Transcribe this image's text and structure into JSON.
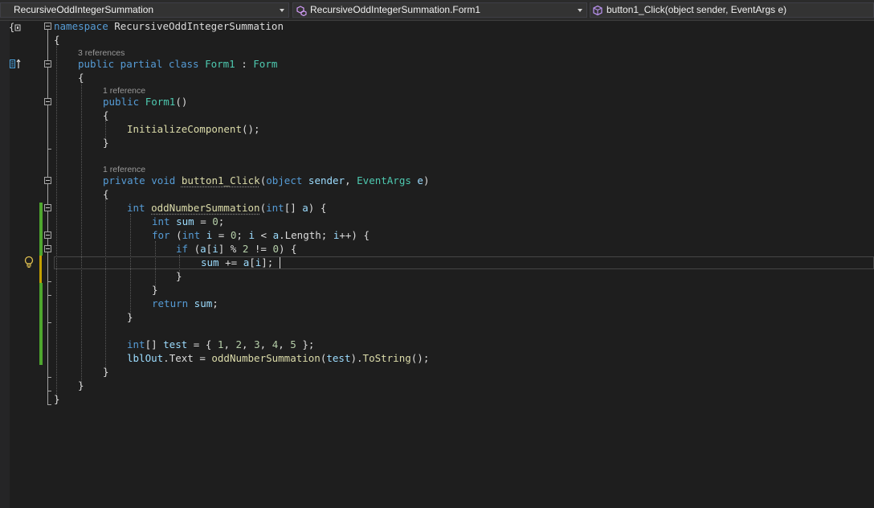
{
  "navbar": {
    "project": "RecursiveOddIntegerSummation",
    "class_member": "RecursiveOddIntegerSummation.Form1",
    "method": "button1_Click(object sender, EventArgs e)"
  },
  "codelens": {
    "class_refs": "3 references",
    "ctor_refs": "1 reference",
    "method_refs": "1 reference"
  },
  "code": {
    "l1": {
      "kw": "namespace",
      "rest": " RecursiveOddIntegerSummation"
    },
    "l2": {
      "p": "{"
    },
    "l3": {
      "kw1": "public",
      "kw2": " partial",
      "kw3": " class",
      "sp": " ",
      "name": "Form1",
      "colon": " : ",
      "base": "Form"
    },
    "l4": {
      "p": "{"
    },
    "l5": {
      "kw": "public",
      "sp": " ",
      "name": "Form1",
      "p": "()"
    },
    "l6": {
      "p": "{"
    },
    "l7": {
      "fn": "InitializeComponent",
      "p": "();"
    },
    "l8": {
      "p": "}"
    },
    "l9": {
      "kw1": "private",
      "kw2": " void",
      "sp": " ",
      "fn": "button1_Click",
      "p1": "(",
      "kw3": "object",
      "v1": " sender",
      "p2": ", ",
      "ty": "EventArgs",
      "v2": " e",
      "p3": ")"
    },
    "l10": {
      "p": "{"
    },
    "l11": {
      "kw": "int",
      "sp": " ",
      "fn": "oddNumberSummation",
      "p1": "(",
      "kw2": "int",
      "p2": "[] ",
      "v": "a",
      "p3": ") {"
    },
    "l12": {
      "kw": "int",
      "v": " sum",
      "p1": " = ",
      "n": "0",
      "p2": ";"
    },
    "l13": {
      "kw": "for",
      "p1": " (",
      "kw2": "int",
      "v1": " i",
      "p2": " = ",
      "n": "0",
      "p3": "; ",
      "v2": "i",
      "p4": " < ",
      "v3": "a",
      "p5": ".",
      "pr": "Length",
      "p6": "; ",
      "v4": "i",
      "p7": "++) {"
    },
    "l14": {
      "kw": "if",
      "p1": " (",
      "v1": "a",
      "p2": "[",
      "v2": "i",
      "p3": "] % ",
      "n1": "2",
      "p4": " != ",
      "n2": "0",
      "p5": ") {"
    },
    "l15": {
      "v1": "sum",
      "p1": " += ",
      "v2": "a",
      "p2": "[",
      "v3": "i",
      "p3": "];"
    },
    "l16": {
      "p": "}"
    },
    "l17": {
      "p": "}"
    },
    "l18": {
      "kw": "return",
      "v": " sum",
      "p": ";"
    },
    "l19": {
      "p": "}"
    },
    "l20": {
      "kw": "int",
      "p1": "[] ",
      "v": "test",
      "p2": " = { ",
      "n1": "1",
      "c1": ", ",
      "n2": "2",
      "c2": ", ",
      "n3": "3",
      "c3": ", ",
      "n4": "4",
      "c4": ", ",
      "n5": "5",
      "p3": " };"
    },
    "l21": {
      "v": "lblOut",
      "p1": ".",
      "pr": "Text",
      "p2": " = ",
      "fn1": "oddNumberSummation",
      "p3": "(",
      "v2": "test",
      "p4": ").",
      "fn2": "ToString",
      "p5": "();"
    },
    "l22": {
      "p": "}"
    },
    "l23": {
      "p": "}"
    },
    "l24": {
      "p": "}"
    }
  },
  "colors": {
    "background": "#1e1e1e",
    "keyword": "#569cd6",
    "type": "#4ec9b0",
    "method": "#dcdcaa",
    "variable": "#9cdcfe",
    "number": "#b5cea8",
    "change_saved": "#4ea72e"
  },
  "icons": [
    "project-cube-icon",
    "class-icon",
    "method-icon",
    "dropdown-arrow-icon",
    "lightbulb-icon",
    "quick-action-icon",
    "fold-icon"
  ]
}
